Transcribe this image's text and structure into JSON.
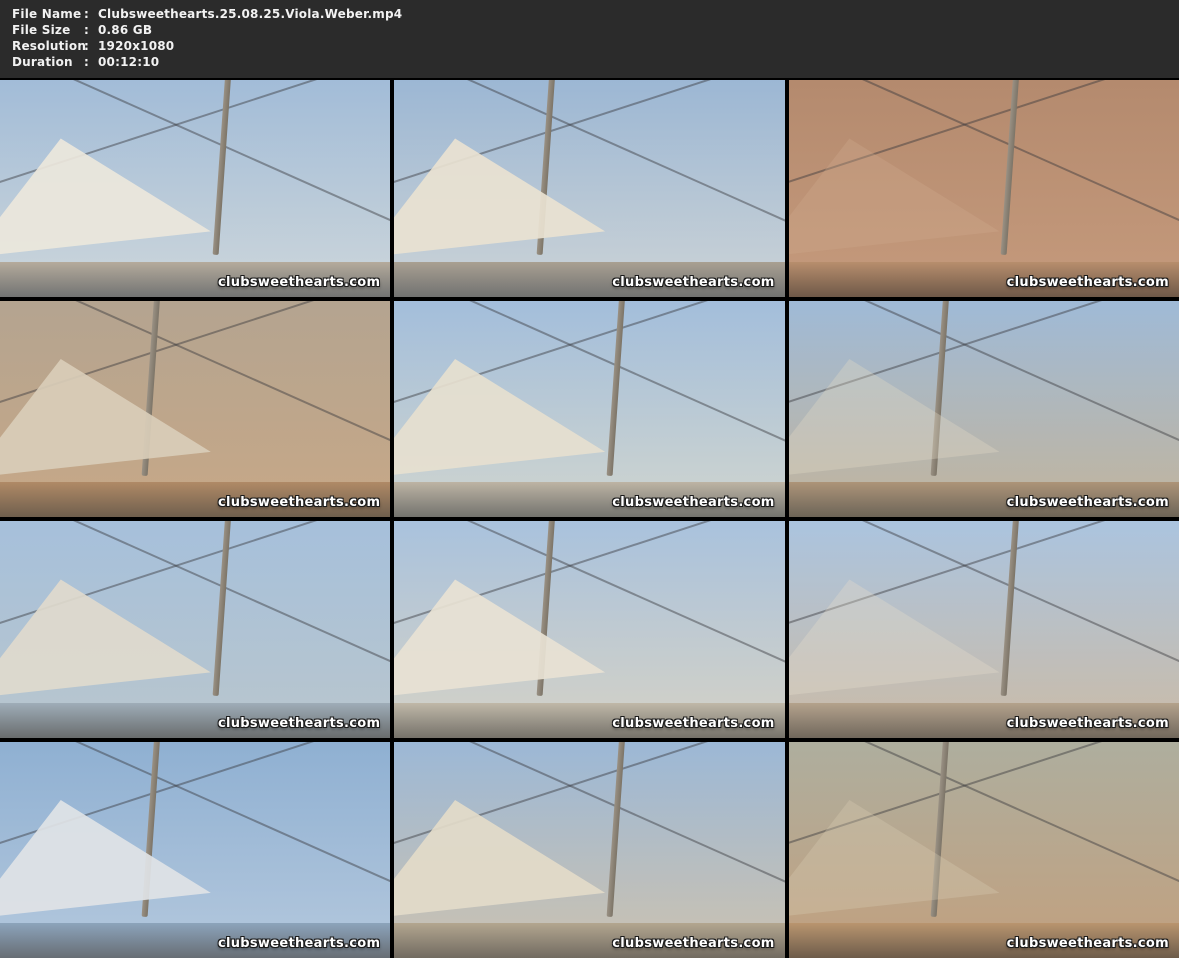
{
  "header": {
    "background": "#2b2b2b",
    "text_color": "#f2f2f2",
    "fields": [
      {
        "label": "File Name",
        "separator": ":",
        "value": "Clubsweethearts.25.08.25.Viola.Weber.mp4"
      },
      {
        "label": "File Size",
        "separator": ":",
        "value": "0.86 GB"
      },
      {
        "label": "Resolution",
        "separator": ":",
        "value": "1920x1080"
      },
      {
        "label": "Duration",
        "separator": ":",
        "value": "00:12:10"
      }
    ]
  },
  "grid": {
    "columns": 3,
    "rows": 4,
    "gap_color": "#000000",
    "watermark": "clubsweethearts.com",
    "thumbnails": [
      {
        "sky_top": "#a2bcd8",
        "sky_bottom": "#cdd6da",
        "sail": "#ece7dc",
        "deck": "#b5ab9c"
      },
      {
        "sky_top": "#9cb7d4",
        "sky_bottom": "#ccd3d6",
        "sail": "#e9e2d1",
        "deck": "#a9a092"
      },
      {
        "sky_top": "#b48a6e",
        "sky_bottom": "#c59a7c",
        "sail": "#cfa98b",
        "deck": "#b78e6d"
      },
      {
        "sky_top": "#b4a490",
        "sky_bottom": "#c7a887",
        "sail": "#d9cdb9",
        "deck": "#b08a66"
      },
      {
        "sky_top": "#a3bedb",
        "sky_bottom": "#d0d5cf",
        "sail": "#e6dfcf",
        "deck": "#bdb4a4"
      },
      {
        "sky_top": "#9fbad7",
        "sky_bottom": "#c2b49c",
        "sail": "#e2d9c6",
        "deck": "#ad9478"
      },
      {
        "sky_top": "#a6c0db",
        "sky_bottom": "#b9c6cd",
        "sail": "#dfdacd",
        "deck": "#9fadb8"
      },
      {
        "sky_top": "#a9c2dd",
        "sky_bottom": "#d5d2c6",
        "sail": "#e8e2d4",
        "deck": "#c0b8a8"
      },
      {
        "sky_top": "#abc4df",
        "sky_bottom": "#cbbba6",
        "sail": "#e5dccb",
        "deck": "#b4a28c"
      },
      {
        "sky_top": "#8fb0d2",
        "sky_bottom": "#b4c8dd",
        "sail": "#dfe3e6",
        "deck": "#8da4bb"
      },
      {
        "sky_top": "#9cb8d6",
        "sky_bottom": "#ccc2b0",
        "sail": "#e3dbc9",
        "deck": "#b3a68f"
      },
      {
        "sky_top": "#aeae9e",
        "sky_bottom": "#c2a07e",
        "sail": "#d8cab2",
        "deck": "#b9956f"
      }
    ]
  }
}
